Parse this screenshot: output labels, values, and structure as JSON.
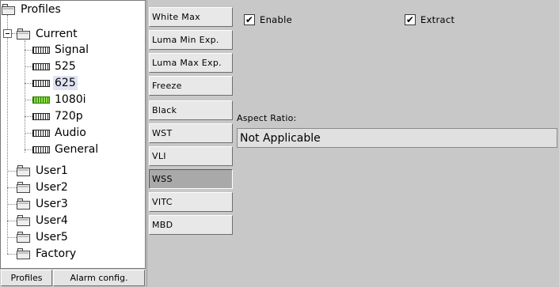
{
  "tree": {
    "root": "Profiles",
    "current": "Current",
    "current_children": [
      "Signal",
      "525",
      "625",
      "1080i",
      "720p",
      "Audio",
      "General"
    ],
    "selected": "625",
    "highlighted_icon": "1080i",
    "others": [
      "User1",
      "User2",
      "User3",
      "User4",
      "User5",
      "Factory"
    ]
  },
  "bottom_tabs": {
    "profiles": "Profiles",
    "alarm": "Alarm config."
  },
  "side_buttons": [
    "White Max",
    "Luma Min Exp.",
    "Luma Max Exp.",
    "Freeze",
    "Black",
    "WST",
    "VLI",
    "WSS",
    "VITC",
    "MBD"
  ],
  "active_button": "WSS",
  "content": {
    "enable_label": "Enable",
    "enable_checked": true,
    "extract_label": "Extract",
    "extract_checked": true,
    "aspect_ratio_label": "Aspect Ratio:",
    "aspect_ratio_value": "Not Applicable"
  },
  "checkmark": "✔"
}
